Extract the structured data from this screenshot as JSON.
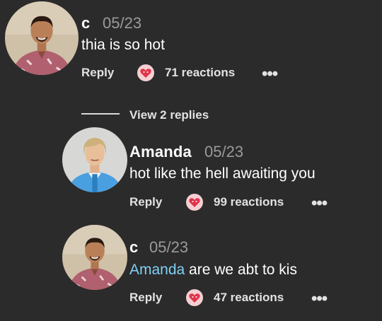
{
  "comments": [
    {
      "author": "c",
      "date": "05/23",
      "text": "thia is so hot",
      "reply_label": "Reply",
      "reactions": "71 reactions",
      "more": "•••"
    },
    {
      "author": "Amanda",
      "date": "05/23",
      "text": "hot like the hell awaiting you",
      "reply_label": "Reply",
      "reactions": "99 reactions",
      "more": "•••"
    },
    {
      "author": "c",
      "date": "05/23",
      "mention": "Amanda",
      "text": " are we abt to kis",
      "reply_label": "Reply",
      "reactions": "47 reactions",
      "more": "•••"
    }
  ],
  "thread": {
    "view_replies_label": "View 2 replies"
  },
  "icons": {
    "reaction": "heart-face-reaction-icon",
    "more": "more-options-icon"
  },
  "colors": {
    "background": "#2b2b2b",
    "mention": "#7fd0f5",
    "muted": "#9a9a9a",
    "reaction_bg": "#f6cfd3",
    "reaction_heart": "#e0344a"
  }
}
